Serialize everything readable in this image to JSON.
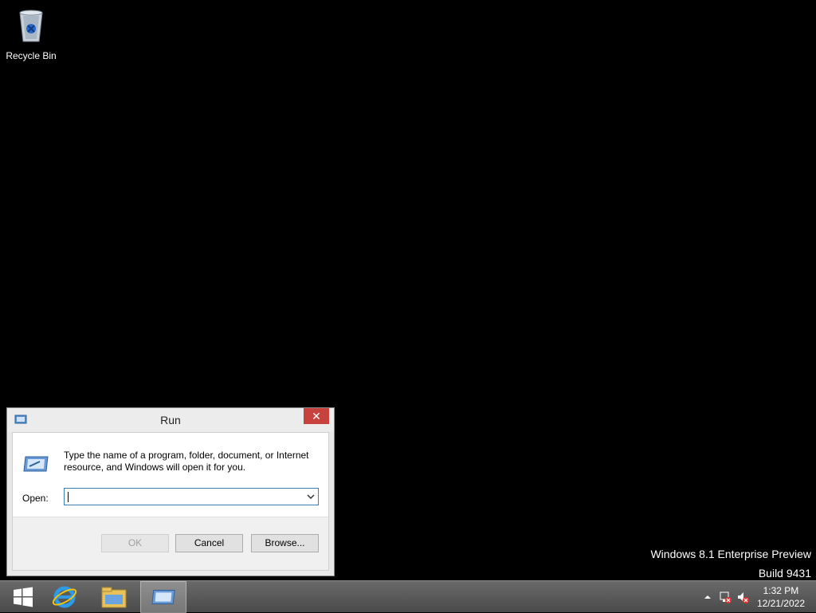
{
  "desktop": {
    "recycle_bin_label": "Recycle Bin",
    "watermark_line1": "Windows 8.1 Enterprise Preview",
    "watermark_line2": "Build 9431"
  },
  "run_dialog": {
    "title": "Run",
    "close_glyph": "✕",
    "description": "Type the name of a program, folder, document, or Internet resource, and Windows will open it for you.",
    "open_label": "Open:",
    "open_value": "",
    "ok_label": "OK",
    "cancel_label": "Cancel",
    "browse_label": "Browse..."
  },
  "taskbar": {
    "items": [
      {
        "icon": "windows-start-icon"
      },
      {
        "icon": "internet-explorer-icon"
      },
      {
        "icon": "file-explorer-icon"
      },
      {
        "icon": "run-app-icon",
        "active": true
      }
    ],
    "tray_icons": [
      "show-hidden-icons-arrow",
      "network-disconnected-icon",
      "volume-muted-icon"
    ],
    "time": "1:32 PM",
    "date": "12/21/2022"
  },
  "colors": {
    "close_button": "#c7413f",
    "input_border": "#3c7fb1",
    "desktop_bg": "#000000"
  }
}
